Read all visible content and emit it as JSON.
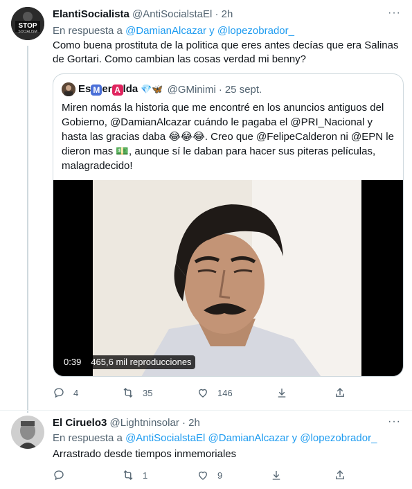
{
  "tweet1": {
    "name": "ElantiSocialista",
    "handle": "@AntiSocialstaEl",
    "dot": "·",
    "time": "2h",
    "reply_prefix": "En respuesta a",
    "reply_to": "@DamianAlcazar y @lopezobrador_",
    "text": "Como buena prostituta de la politica que eres antes decías que era Salinas de Gortari. Como cambian las cosas verdad mi benny?",
    "avatar_text": "STOP",
    "avatar_subtext": "SOCIALISM",
    "replies": "4",
    "retweets": "35",
    "likes": "146"
  },
  "quote": {
    "name_prefix": "Es",
    "name_m": "M",
    "name_mid": "er",
    "name_a": "A",
    "name_suffix": "lda",
    "name_emojis": "💎🦋",
    "handle": "@GMinimi",
    "dot": "·",
    "time": "25 sept.",
    "text": "Miren nomás la historia que me encontré en los anuncios antiguos del Gobierno, @DamianAlcazar cuándo le pagaba el @PRI_Nacional y hasta las gracias daba 😂😂😂. Creo que @FelipeCalderon ni @EPN le dieron mas 💵, aunque sí le daban para hacer sus piteras películas, malagradecido!",
    "video_time": "0:39",
    "video_views": "465,6 mil reproducciones"
  },
  "tweet2": {
    "name": "El Ciruelo3",
    "handle": "@Lightninsolar",
    "dot": "·",
    "time": "2h",
    "reply_prefix": "En respuesta a",
    "reply_to": "@AntiSocialstaEl @DamianAlcazar y @lopezobrador_",
    "text": "Arrastrado desde tiempos inmemoriales",
    "replies": "",
    "retweets": "1",
    "likes": "9"
  },
  "more_glyph": "···",
  "colors": {
    "link": "#1d9bf0",
    "muted": "#536471",
    "border": "#cfd9de"
  },
  "icons": [
    "reply-icon",
    "retweet-icon",
    "like-icon",
    "download-icon",
    "share-icon",
    "more-icon"
  ]
}
